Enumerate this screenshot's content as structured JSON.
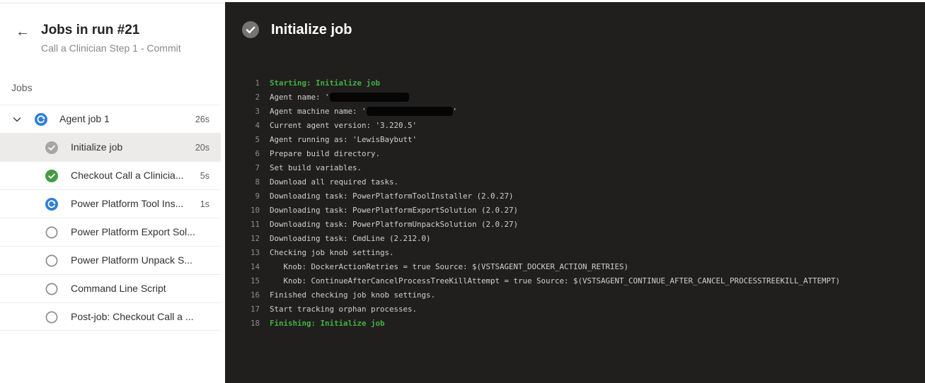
{
  "sidebar": {
    "back_icon": "←",
    "title": "Jobs in run #21",
    "subtitle": "Call a Clinician Step 1 - Commit",
    "section_label": "Jobs",
    "group": {
      "label": "Agent job 1",
      "duration": "26s",
      "status": "running",
      "expanded": true
    },
    "steps": [
      {
        "label": "Initialize job",
        "duration": "20s",
        "status": "done-neutral",
        "selected": true
      },
      {
        "label": "Checkout Call a Clinicia...",
        "duration": "5s",
        "status": "done-success",
        "selected": false
      },
      {
        "label": "Power Platform Tool Ins...",
        "duration": "1s",
        "status": "running",
        "selected": false
      },
      {
        "label": "Power Platform Export Sol...",
        "duration": "",
        "status": "pending",
        "selected": false
      },
      {
        "label": "Power Platform Unpack S...",
        "duration": "",
        "status": "pending",
        "selected": false
      },
      {
        "label": "Command Line Script",
        "duration": "",
        "status": "pending",
        "selected": false
      },
      {
        "label": "Post-job: Checkout Call a ...",
        "duration": "",
        "status": "pending",
        "selected": false
      }
    ]
  },
  "log_panel": {
    "title": "Initialize job",
    "title_status": "done-neutral",
    "lines": [
      {
        "num": "1",
        "text": "Starting: Initialize job",
        "color": "green"
      },
      {
        "num": "2",
        "text": "Agent name: '",
        "redacted": true,
        "redact_w": 112,
        "suffix": ""
      },
      {
        "num": "3",
        "text": "Agent machine name: '",
        "redacted": true,
        "redact_w": 122,
        "suffix": "'"
      },
      {
        "num": "4",
        "text": "Current agent version: '3.220.5'"
      },
      {
        "num": "5",
        "text": "Agent running as: 'LewisBaybutt'"
      },
      {
        "num": "6",
        "text": "Prepare build directory."
      },
      {
        "num": "7",
        "text": "Set build variables."
      },
      {
        "num": "8",
        "text": "Download all required tasks."
      },
      {
        "num": "9",
        "text": "Downloading task: PowerPlatformToolInstaller (2.0.27)"
      },
      {
        "num": "10",
        "text": "Downloading task: PowerPlatformExportSolution (2.0.27)"
      },
      {
        "num": "11",
        "text": "Downloading task: PowerPlatformUnpackSolution (2.0.27)"
      },
      {
        "num": "12",
        "text": "Downloading task: CmdLine (2.212.0)"
      },
      {
        "num": "13",
        "text": "Checking job knob settings."
      },
      {
        "num": "14",
        "text": "   Knob: DockerActionRetries = true Source: $(VSTSAGENT_DOCKER_ACTION_RETRIES)"
      },
      {
        "num": "15",
        "text": "   Knob: ContinueAfterCancelProcessTreeKillAttempt = true Source: $(VSTSAGENT_CONTINUE_AFTER_CANCEL_PROCESSTREEKILL_ATTEMPT)"
      },
      {
        "num": "16",
        "text": "Finished checking job knob settings."
      },
      {
        "num": "17",
        "text": "Start tracking orphan processes."
      },
      {
        "num": "18",
        "text": "Finishing: Initialize job",
        "color": "green"
      }
    ]
  },
  "colors": {
    "log_background": "#211f1e",
    "log_text": "#d2d0ce",
    "log_green": "#42b142",
    "running_blue": "#2f80d7",
    "success_green": "#459c45",
    "neutral_done_gray": "#a8a6a4",
    "selected_row_bg": "#edebe9"
  }
}
